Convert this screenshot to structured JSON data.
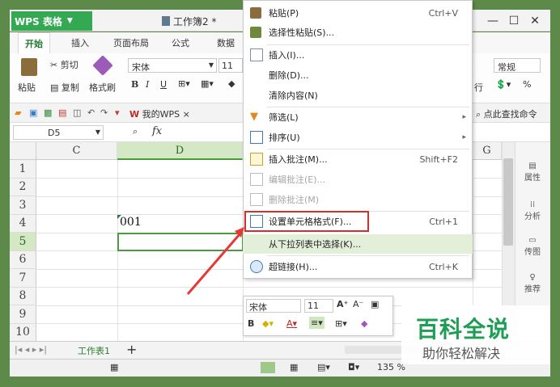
{
  "app": {
    "name": "WPS 表格",
    "doc_tab": "工作簿2 *"
  },
  "menu": {
    "tabs": [
      "开始",
      "插入",
      "页面布局",
      "公式",
      "数据"
    ]
  },
  "ribbon": {
    "paste": "粘贴",
    "cut": "剪切",
    "copy": "复制",
    "format_painter": "格式刷",
    "font_name": "宋体",
    "font_size": "11",
    "right_group_label": "行",
    "number_format": "常规",
    "percent": "%"
  },
  "quickbar": {
    "my_wps": "我的WPS",
    "find_command": "点此查找命令"
  },
  "formula_bar": {
    "cell_ref": "D5",
    "fx": "fx"
  },
  "grid": {
    "columns": [
      "C",
      "D",
      "G"
    ],
    "rows": [
      "1",
      "2",
      "3",
      "4",
      "5",
      "6",
      "7",
      "8",
      "9",
      "10"
    ],
    "cell_D4": "001"
  },
  "context_menu": {
    "items": [
      {
        "label": "粘贴(P)",
        "shortcut": "Ctrl+V"
      },
      {
        "label": "选择性粘贴(S)...",
        "shortcut": ""
      },
      {
        "label": "插入(I)...",
        "shortcut": ""
      },
      {
        "label": "删除(D)...",
        "shortcut": ""
      },
      {
        "label": "清除内容(N)",
        "shortcut": ""
      },
      {
        "label": "筛选(L)",
        "shortcut": ""
      },
      {
        "label": "排序(U)",
        "shortcut": ""
      },
      {
        "label": "插入批注(M)...",
        "shortcut": "Shift+F2"
      },
      {
        "label": "编辑批注(E)...",
        "shortcut": ""
      },
      {
        "label": "删除批注(M)",
        "shortcut": ""
      },
      {
        "label": "设置单元格格式(F)...",
        "shortcut": "Ctrl+1"
      },
      {
        "label": "从下拉列表中选择(K)...",
        "shortcut": ""
      },
      {
        "label": "超链接(H)...",
        "shortcut": "Ctrl+K"
      }
    ]
  },
  "mini_toolbar": {
    "font": "宋体",
    "size": "11",
    "bold": "B"
  },
  "side_panel": {
    "items": [
      "属性",
      "分析",
      "传图",
      "推荐"
    ]
  },
  "sheet_tabs": {
    "active": "工作表1",
    "add": "+"
  },
  "status": {
    "zoom": "135 %"
  },
  "watermark": {
    "title": "百科全说",
    "subtitle": "助你轻松解决"
  },
  "colors": {
    "accent": "#34a853",
    "selection": "#4a9b3c",
    "arrow": "#e53935",
    "highlight_box": "#d32f2f"
  }
}
